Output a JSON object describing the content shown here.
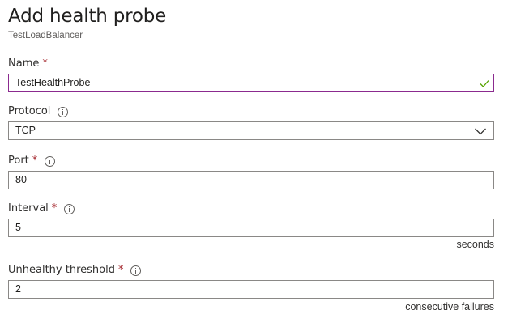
{
  "header": {
    "title": "Add health probe",
    "subtitle": "TestLoadBalancer"
  },
  "form": {
    "name": {
      "label": "Name",
      "required": "*",
      "value": "TestHealthProbe",
      "validation_icon": "checkmark-icon"
    },
    "protocol": {
      "label": "Protocol",
      "value": "TCP",
      "info_icon": "info-icon",
      "dropdown_icon": "chevron-down-icon"
    },
    "port": {
      "label": "Port",
      "required": "*",
      "value": "80",
      "info_icon": "info-icon"
    },
    "interval": {
      "label": "Interval",
      "required": "*",
      "value": "5",
      "unit": "seconds",
      "info_icon": "info-icon"
    },
    "unhealthy_threshold": {
      "label": "Unhealthy threshold",
      "required": "*",
      "value": "2",
      "unit": "consecutive failures",
      "info_icon": "info-icon"
    }
  },
  "colors": {
    "active_border": "#8b2a8f",
    "required": "#a4262c",
    "valid_check": "#57a300",
    "field_border": "#8a8886"
  }
}
